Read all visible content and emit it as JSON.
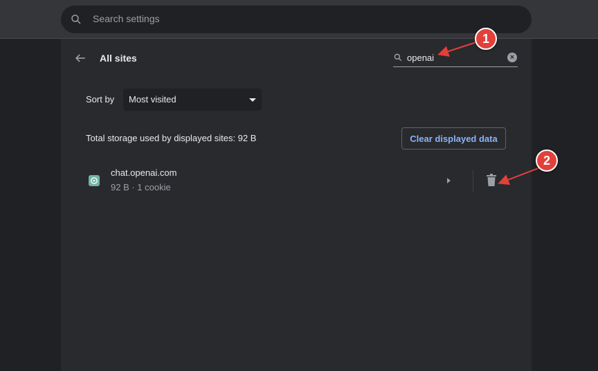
{
  "header": {
    "search_placeholder": "Search settings"
  },
  "page": {
    "title": "All sites",
    "site_search_value": "openai"
  },
  "sort": {
    "label": "Sort by",
    "selected": "Most visited"
  },
  "storage": {
    "text": "Total storage used by displayed sites: 92 B",
    "clear_label": "Clear displayed data"
  },
  "sites": [
    {
      "name": "chat.openai.com",
      "details": "92 B · 1 cookie"
    }
  ],
  "annotations": [
    {
      "label": "1"
    },
    {
      "label": "2"
    }
  ],
  "colors": {
    "accent": "#8ab4f8",
    "badge": "#e2403a",
    "panel": "#292a2d",
    "page": "#202124"
  }
}
